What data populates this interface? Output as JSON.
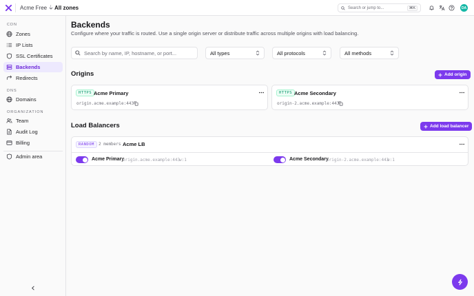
{
  "topbar": {
    "org": "Acme Free",
    "separator": "/",
    "breadcrumb": "All zones",
    "search_placeholder": "Search or jump to...",
    "search_shortcut": "⌘K",
    "avatar_initials": "DA"
  },
  "sidebar": {
    "sections": [
      {
        "title": "CDN",
        "items": [
          {
            "label": "Zones",
            "icon": "globe-icon"
          },
          {
            "label": "IP Lists",
            "icon": "list-icon"
          },
          {
            "label": "SSL Certificates",
            "icon": "shield-icon"
          },
          {
            "label": "Backends",
            "icon": "server-icon",
            "active": true
          },
          {
            "label": "Redirects",
            "icon": "redirect-icon"
          }
        ]
      },
      {
        "title": "DNS",
        "items": [
          {
            "label": "Domains",
            "icon": "globe-icon"
          }
        ]
      },
      {
        "title": "ORGANIZATION",
        "items": [
          {
            "label": "Team",
            "icon": "users-icon"
          },
          {
            "label": "Audit Log",
            "icon": "file-icon"
          },
          {
            "label": "Billing",
            "icon": "card-icon"
          }
        ]
      }
    ],
    "admin": {
      "label": "Admin area",
      "icon": "shield-icon"
    }
  },
  "page": {
    "title": "Backends",
    "subtitle": "Configure where your traffic is routed. Use a single origin server or distribute traffic across multiple origins with load balancing."
  },
  "filters": {
    "search_placeholder": "Search by name, IP, hostname, or port...",
    "types": "All types",
    "protocols": "All protocols",
    "methods": "All methods"
  },
  "origins": {
    "heading": "Origins",
    "add_label": "Add origin",
    "items": [
      {
        "protocol": "HTTPS",
        "name": "Acme Primary",
        "address": "origin.acme.example:443"
      },
      {
        "protocol": "HTTPS",
        "name": "Acme Secondary",
        "address": "origin-2.acme.example:443"
      }
    ]
  },
  "load_balancers": {
    "heading": "Load Balancers",
    "add_label": "Add load balancer",
    "items": [
      {
        "method": "RANDOM",
        "members_count": "2 members",
        "name": "Acme LB",
        "members": [
          {
            "name": "Acme Primary",
            "address": "origin.acme.example:443",
            "weight": "w:1",
            "enabled": true
          },
          {
            "name": "Acme Secondary",
            "address": "origin-2.acme.example:443",
            "weight": "w:1",
            "enabled": true
          }
        ]
      }
    ]
  },
  "colors": {
    "accent": "#7c3aed",
    "avatar": "#14b8a6",
    "https_tag": "#059669"
  }
}
